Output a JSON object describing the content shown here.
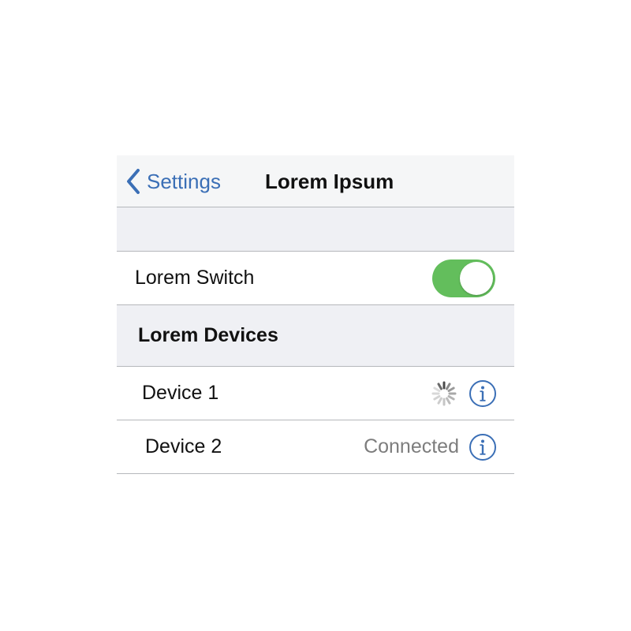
{
  "navbar": {
    "back_label": "Settings",
    "title": "Lorem Ipsum"
  },
  "switch_row": {
    "label": "Lorem Switch",
    "toggle_on": true
  },
  "section": {
    "title": "Lorem Devices"
  },
  "devices": [
    {
      "label": "Device 1",
      "status": "",
      "indicator": "spinner-icon"
    },
    {
      "label": "Device 2",
      "status": "Connected",
      "indicator": "info-icon"
    }
  ],
  "colors": {
    "accent": "#3b6fb6",
    "toggle_on": "#63be5c",
    "group_background": "#eff0f4",
    "separator": "#b5b7bb"
  }
}
